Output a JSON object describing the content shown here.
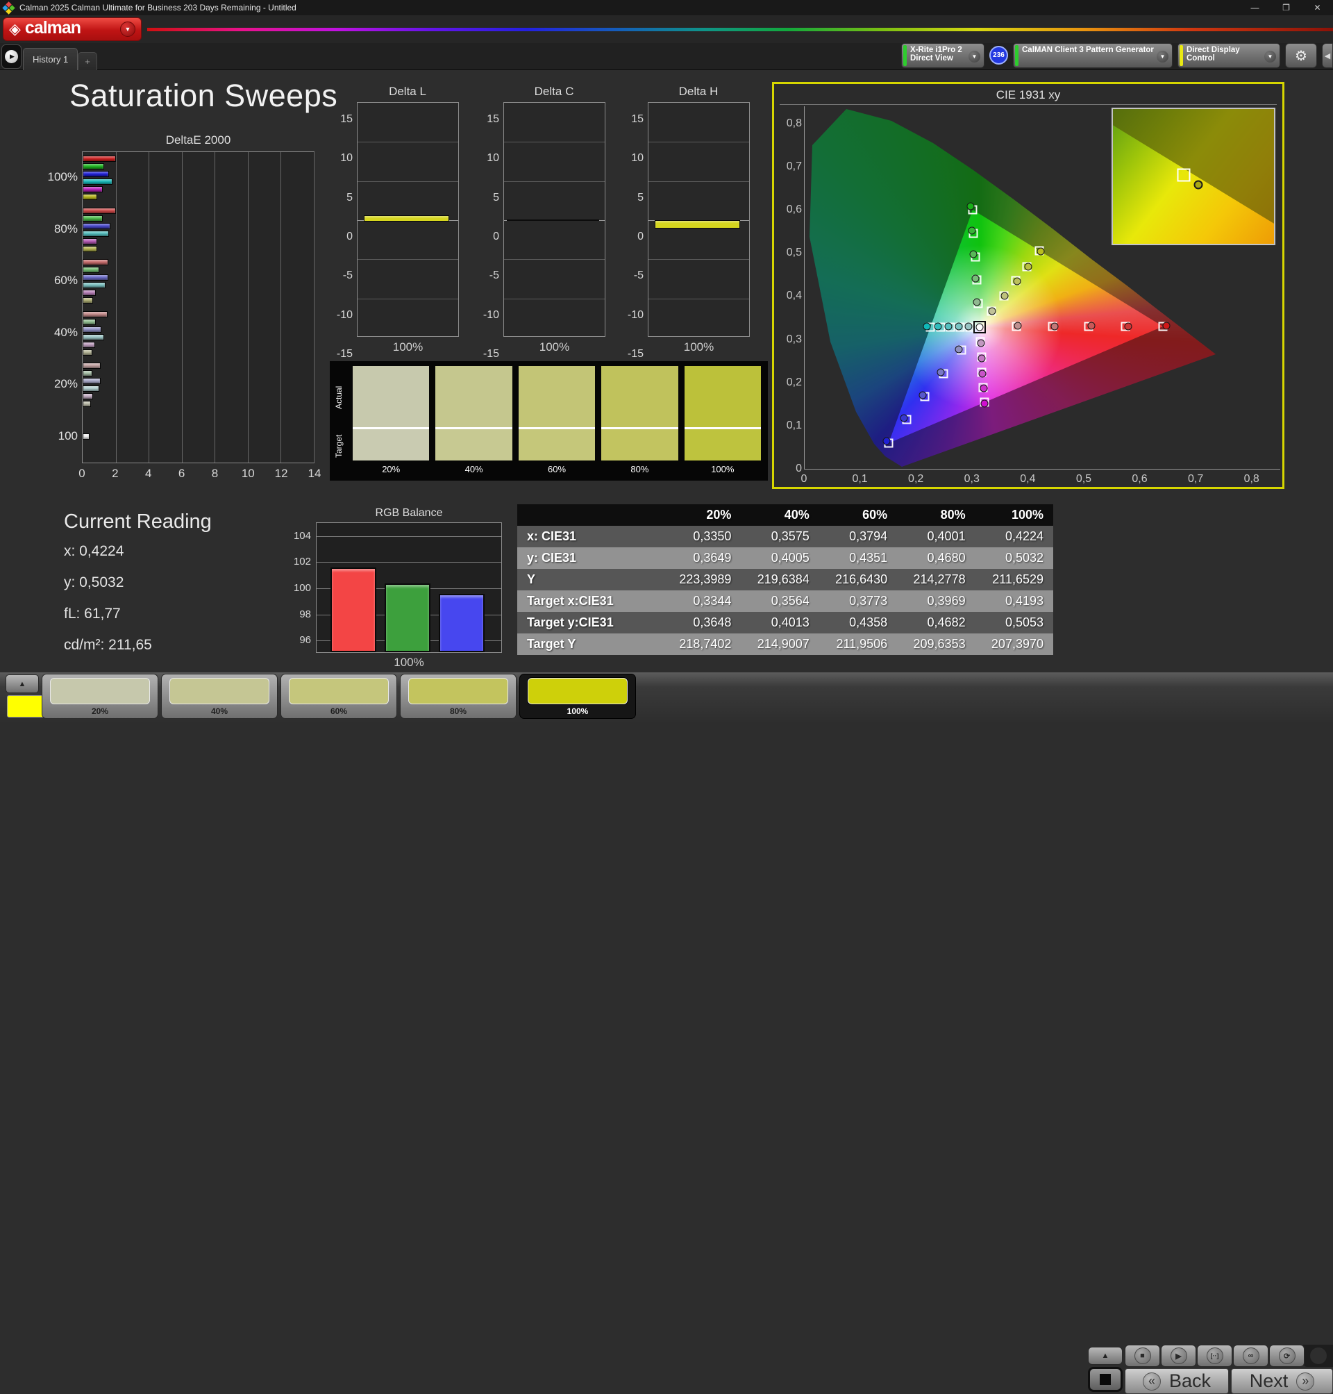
{
  "window": {
    "title": "Calman 2025 Calman Ultimate for Business 203 Days Remaining  - Untitled",
    "minimize": "—",
    "restore": "❐",
    "close": "✕"
  },
  "icons": {
    "logo_glyph": "◈",
    "down_caret": "▼",
    "left_caret": "◀",
    "play_small": "▶",
    "up_arrow": "▲",
    "gear": "⚙",
    "plus": "+",
    "stop": "■",
    "play": "▶",
    "hold": "[··]",
    "infinity": "∞",
    "refresh": "⟳",
    "back_chevrons": "«",
    "next_chevrons": "»"
  },
  "header": {
    "logo_text": "calman"
  },
  "tabs": {
    "history": "History 1"
  },
  "meters": {
    "meter_line1": "X-Rite i1Pro 2",
    "meter_line2": "Direct View",
    "badge": "236",
    "pattern_label": "CalMAN Client 3 Pattern Generator",
    "display_label": "Direct Display Control",
    "meter_accent": "#2ecc2e",
    "pattern_accent": "#2ecc2e",
    "display_accent": "#e8e814"
  },
  "page": {
    "title": "Saturation Sweeps"
  },
  "current_reading": {
    "title": "Current Reading",
    "lines": [
      "x: 0,4224",
      "y: 0,5032",
      "fL: 61,77",
      "cd/m²: 211,65"
    ]
  },
  "swatch_compare": {
    "row_labels": [
      "Actual",
      "Target"
    ],
    "columns": [
      {
        "label": "20%",
        "actual": "#c7c9ad",
        "target": "#c9cbb1"
      },
      {
        "label": "40%",
        "actual": "#c5c78e",
        "target": "#c7c992"
      },
      {
        "label": "60%",
        "actual": "#c3c576",
        "target": "#c5c77a"
      },
      {
        "label": "80%",
        "actual": "#c0c25c",
        "target": "#c2c460"
      },
      {
        "label": "100%",
        "actual": "#bcc13a",
        "target": "#bec33e"
      }
    ]
  },
  "chart_data": [
    {
      "type": "bar",
      "orient": "horizontal",
      "title": "DeltaE 2000",
      "xlim": [
        0,
        14
      ],
      "xticks": [
        0,
        2,
        4,
        6,
        8,
        10,
        12,
        14
      ],
      "series_names": [
        "red",
        "green",
        "blue",
        "cyan",
        "magenta",
        "yellow"
      ],
      "groups": [
        {
          "label": "100%",
          "values": [
            2.0,
            1.3,
            1.6,
            1.8,
            1.2,
            0.9
          ],
          "colors": [
            "#cc2020",
            "#1db520",
            "#2020d8",
            "#17b8b8",
            "#bb22bb",
            "#b8b81e"
          ]
        },
        {
          "label": "80%",
          "values": [
            2.0,
            1.2,
            1.7,
            1.6,
            0.9,
            0.9
          ],
          "colors": [
            "#cc4848",
            "#4ab948",
            "#4848cc",
            "#52bcbc",
            "#b65ab6",
            "#b3b34e"
          ]
        },
        {
          "label": "60%",
          "values": [
            1.55,
            1.0,
            1.55,
            1.4,
            0.8,
            0.65
          ],
          "colors": [
            "#c66a6a",
            "#6fba6f",
            "#6a6ac6",
            "#79bfbf",
            "#b67eb6",
            "#b1b176"
          ]
        },
        {
          "label": "40%",
          "values": [
            1.5,
            0.8,
            1.15,
            1.3,
            0.75,
            0.6
          ],
          "colors": [
            "#c28888",
            "#8fbd8f",
            "#8f8fc4",
            "#9cc6c6",
            "#bd9cbd",
            "#b5b596"
          ]
        },
        {
          "label": "20%",
          "values": [
            1.1,
            0.6,
            1.1,
            1.0,
            0.65,
            0.5
          ],
          "colors": [
            "#c0a0a0",
            "#a8c0a8",
            "#a8a8c8",
            "#b0cccc",
            "#c4aec4",
            "#bcbcaa"
          ]
        },
        {
          "label": "100",
          "values": [
            0.4
          ],
          "colors": [
            "#f2f2f2"
          ]
        }
      ]
    },
    {
      "type": "bar",
      "title": "Delta L",
      "ylim": [
        -15,
        15
      ],
      "yticks": [
        15,
        10,
        5,
        0,
        -5,
        -10,
        -15
      ],
      "xlabel": "100%",
      "value": 0.6,
      "color": "#d6d61e"
    },
    {
      "type": "bar",
      "title": "Delta C",
      "ylim": [
        -15,
        15
      ],
      "yticks": [
        15,
        10,
        5,
        0,
        -5,
        -10,
        -15
      ],
      "xlabel": "100%",
      "value": 0.0,
      "color": "#0c0c0c"
    },
    {
      "type": "bar",
      "title": "Delta H",
      "ylim": [
        -15,
        15
      ],
      "yticks": [
        15,
        10,
        5,
        0,
        -5,
        -10,
        -15
      ],
      "xlabel": "100%",
      "value": -0.9,
      "color": "#d6d61e"
    },
    {
      "type": "bar",
      "title": "RGB Balance",
      "xlabel": "100%",
      "categories": [
        "R",
        "G",
        "B"
      ],
      "values": [
        101.6,
        100.35,
        99.55
      ],
      "colors": [
        "#f34545",
        "#3da03d",
        "#4747ef"
      ],
      "ylim": [
        95,
        105
      ],
      "yticks": [
        104,
        102,
        100,
        98,
        96
      ]
    },
    {
      "type": "scatter",
      "title": "CIE 1931 xy",
      "xlim": [
        0,
        0.85
      ],
      "ylim": [
        0,
        0.84
      ],
      "xtick_labels": [
        "0",
        "0,1",
        "0,2",
        "0,3",
        "0,4",
        "0,5",
        "0,6",
        "0,7",
        "0,8"
      ],
      "xtick_values": [
        0,
        0.1,
        0.2,
        0.3,
        0.4,
        0.5,
        0.6,
        0.7,
        0.8
      ],
      "ytick_labels": [
        "0,8",
        "0,7",
        "0,6",
        "0,5",
        "0,4",
        "0,3",
        "0,2",
        "0,1",
        "0"
      ],
      "ytick_values": [
        0.8,
        0.7,
        0.6,
        0.5,
        0.4,
        0.3,
        0.2,
        0.1,
        0
      ],
      "white_point": [
        0.3127,
        0.329
      ],
      "series": [
        {
          "name": "red",
          "targets": [
            [
              0.378,
              0.33
            ],
            [
              0.443,
              0.33
            ],
            [
              0.508,
              0.33
            ],
            [
              0.573,
              0.33
            ],
            [
              0.64,
              0.33
            ]
          ],
          "measured": [
            [
              0.381,
              0.331
            ],
            [
              0.447,
              0.33
            ],
            [
              0.512,
              0.331
            ],
            [
              0.578,
              0.33
            ],
            [
              0.646,
              0.331
            ]
          ],
          "colors": [
            "#c09090",
            "#c47878",
            "#c85858",
            "#cc3838",
            "#d01818"
          ]
        },
        {
          "name": "green",
          "targets": [
            [
              0.31,
              0.383
            ],
            [
              0.308,
              0.437
            ],
            [
              0.305,
              0.491
            ],
            [
              0.302,
              0.546
            ],
            [
              0.3,
              0.6
            ]
          ],
          "measured": [
            [
              0.308,
              0.386
            ],
            [
              0.305,
              0.441
            ],
            [
              0.302,
              0.497
            ],
            [
              0.299,
              0.552
            ],
            [
              0.296,
              0.608
            ]
          ],
          "colors": [
            "#90b890",
            "#78bc78",
            "#58b858",
            "#38b438",
            "#18b018"
          ]
        },
        {
          "name": "blue",
          "targets": [
            [
              0.28,
              0.275
            ],
            [
              0.248,
              0.221
            ],
            [
              0.215,
              0.167
            ],
            [
              0.183,
              0.114
            ],
            [
              0.15,
              0.06
            ]
          ],
          "measured": [
            [
              0.276,
              0.277
            ],
            [
              0.243,
              0.223
            ],
            [
              0.211,
              0.17
            ],
            [
              0.178,
              0.117
            ],
            [
              0.147,
              0.064
            ]
          ],
          "colors": [
            "#9090c0",
            "#7878c8",
            "#5858cc",
            "#3838d0",
            "#2020d4"
          ]
        },
        {
          "name": "cyan",
          "targets": [
            [
              0.295,
              0.329
            ],
            [
              0.278,
              0.329
            ],
            [
              0.261,
              0.329
            ],
            [
              0.243,
              0.329
            ],
            [
              0.225,
              0.329
            ]
          ],
          "measured": [
            [
              0.293,
              0.33
            ],
            [
              0.275,
              0.33
            ],
            [
              0.257,
              0.33
            ],
            [
              0.238,
              0.33
            ],
            [
              0.219,
              0.33
            ]
          ],
          "colors": [
            "#98c4c4",
            "#78c4c4",
            "#54c0c0",
            "#30bcbc",
            "#10b8b8"
          ]
        },
        {
          "name": "magenta",
          "targets": [
            [
              0.314,
              0.294
            ],
            [
              0.316,
              0.259
            ],
            [
              0.317,
              0.224
            ],
            [
              0.319,
              0.189
            ],
            [
              0.321,
              0.154
            ]
          ],
          "measured": [
            [
              0.315,
              0.292
            ],
            [
              0.317,
              0.256
            ],
            [
              0.318,
              0.221
            ],
            [
              0.32,
              0.186
            ],
            [
              0.322,
              0.151
            ]
          ],
          "colors": [
            "#c098c0",
            "#c478c4",
            "#c854c8",
            "#cc30cc",
            "#d010d0"
          ]
        },
        {
          "name": "yellow",
          "targets": [
            [
              0.3344,
              0.3648
            ],
            [
              0.3564,
              0.4013
            ],
            [
              0.3773,
              0.4358
            ],
            [
              0.3969,
              0.4682
            ],
            [
              0.4193,
              0.5053
            ]
          ],
          "measured": [
            [
              0.335,
              0.3649
            ],
            [
              0.3575,
              0.4005
            ],
            [
              0.3794,
              0.4351
            ],
            [
              0.4001,
              0.468
            ],
            [
              0.4224,
              0.5032
            ]
          ],
          "colors": [
            "#c0c298",
            "#bec27c",
            "#bcc05c",
            "#bac040",
            "#b8be20"
          ]
        }
      ]
    },
    {
      "type": "table",
      "columns": [
        "20%",
        "40%",
        "60%",
        "80%",
        "100%"
      ],
      "rows": [
        {
          "label": "x: CIE31",
          "values": [
            "0,3350",
            "0,3575",
            "0,3794",
            "0,4001",
            "0,4224"
          ]
        },
        {
          "label": "y: CIE31",
          "values": [
            "0,3649",
            "0,4005",
            "0,4351",
            "0,4680",
            "0,5032"
          ]
        },
        {
          "label": "Y",
          "values": [
            "223,3989",
            "219,6384",
            "216,6430",
            "214,2778",
            "211,6529"
          ]
        },
        {
          "label": "Target x:CIE31",
          "values": [
            "0,3344",
            "0,3564",
            "0,3773",
            "0,3969",
            "0,4193"
          ]
        },
        {
          "label": "Target y:CIE31",
          "values": [
            "0,3648",
            "0,4013",
            "0,4358",
            "0,4682",
            "0,5053"
          ]
        },
        {
          "label": "Target Y",
          "values": [
            "218,7402",
            "214,9007",
            "211,9506",
            "209,6353",
            "207,3970"
          ]
        }
      ],
      "row_shades": [
        "#565656",
        "#929292",
        "#565656",
        "#929292",
        "#565656",
        "#929292"
      ]
    }
  ],
  "bottom_bar": {
    "active_color": "#ffff00",
    "swatches": [
      {
        "label": "20%",
        "color": "#c6c8ac",
        "selected": false
      },
      {
        "label": "40%",
        "color": "#c5c694",
        "selected": false
      },
      {
        "label": "60%",
        "color": "#c5c67c",
        "selected": false
      },
      {
        "label": "80%",
        "color": "#c3c45e",
        "selected": false
      },
      {
        "label": "100%",
        "color": "#ced00a",
        "selected": true
      }
    ],
    "back_label": "Back",
    "next_label": "Next"
  }
}
